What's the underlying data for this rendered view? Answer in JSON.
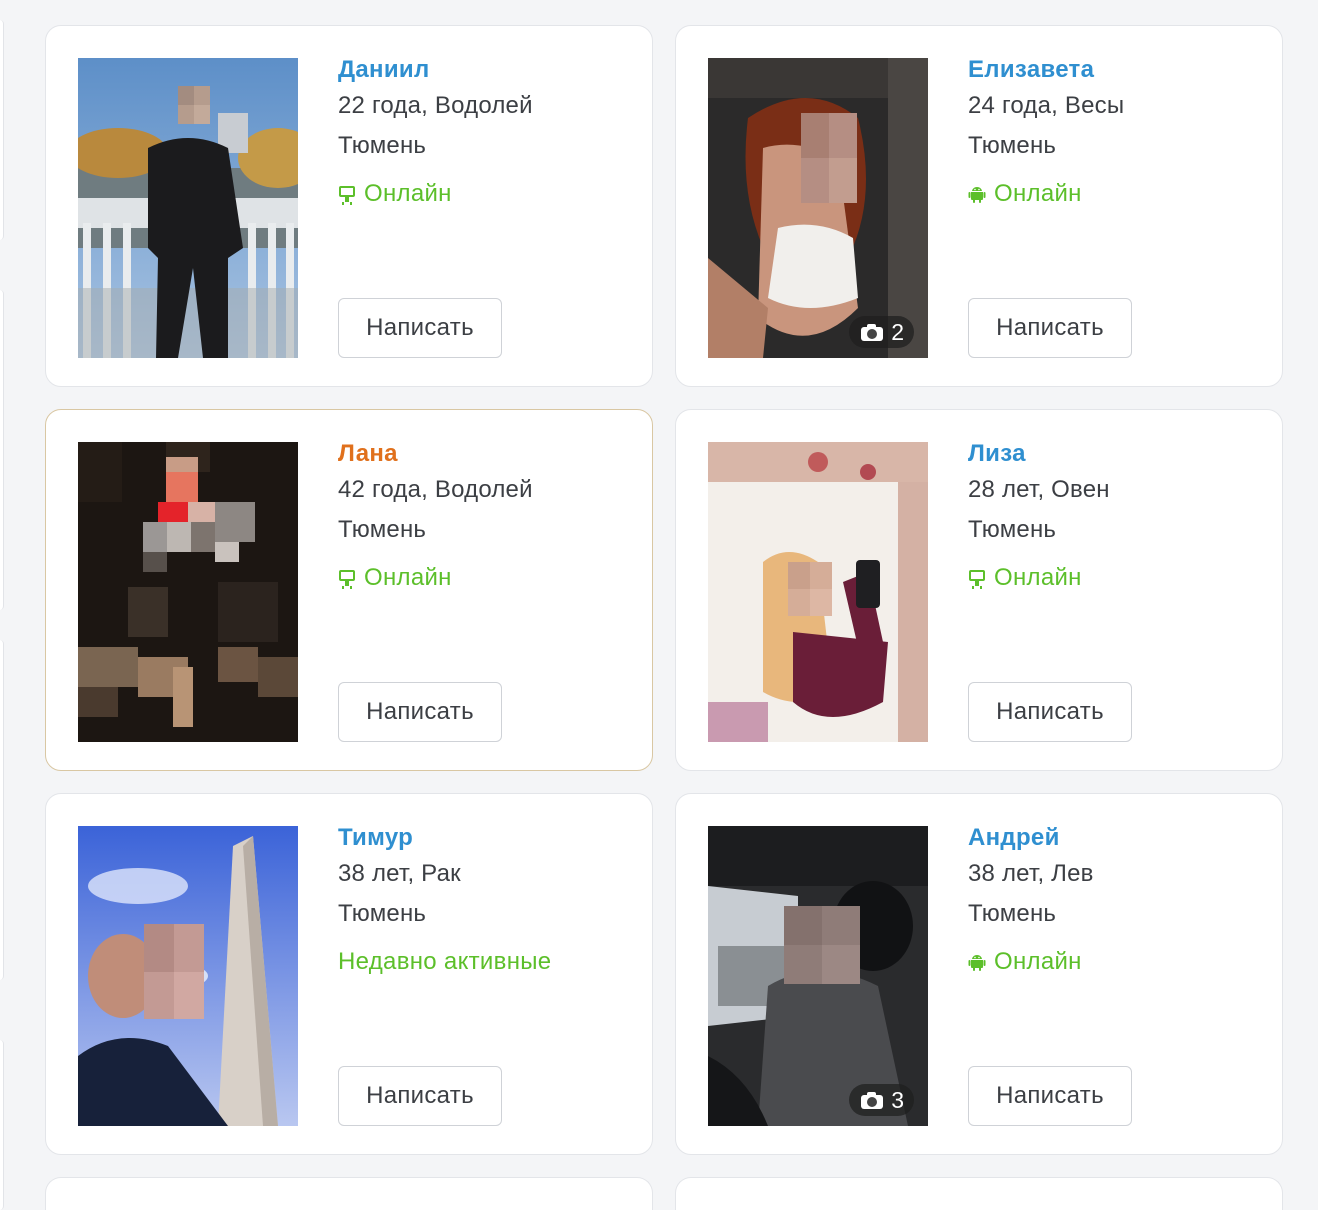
{
  "profiles": [
    {
      "name": "Даниил",
      "age_sign": "22 года, Водолей",
      "city": "Тюмень",
      "status": "Онлайн",
      "status_icon": "monitor-icon",
      "button": "Написать",
      "name_color": "#2f8fd0",
      "highlight": false,
      "photo_count": null
    },
    {
      "name": "Елизавета",
      "age_sign": "24 года, Весы",
      "city": "Тюмень",
      "status": "Онлайн",
      "status_icon": "android-icon",
      "button": "Написать",
      "name_color": "#2f8fd0",
      "highlight": false,
      "photo_count": "2"
    },
    {
      "name": "Лана",
      "age_sign": "42 года, Водолей",
      "city": "Тюмень",
      "status": "Онлайн",
      "status_icon": "monitor-icon",
      "button": "Написать",
      "name_color": "#e0701c",
      "highlight": true,
      "photo_count": null
    },
    {
      "name": "Лиза",
      "age_sign": "28 лет, Овен",
      "city": "Тюмень",
      "status": "Онлайн",
      "status_icon": "monitor-icon",
      "button": "Написать",
      "name_color": "#2f8fd0",
      "highlight": false,
      "photo_count": null
    },
    {
      "name": "Тимур",
      "age_sign": "38 лет, Рак",
      "city": "Тюмень",
      "status": "Недавно активные",
      "status_icon": null,
      "button": "Написать",
      "name_color": "#2f8fd0",
      "highlight": false,
      "photo_count": null
    },
    {
      "name": "Андрей",
      "age_sign": "38 лет, Лев",
      "city": "Тюмень",
      "status": "Онлайн",
      "status_icon": "android-icon",
      "button": "Написать",
      "name_color": "#2f8fd0",
      "highlight": false,
      "photo_count": "3"
    }
  ],
  "colors": {
    "name_link": "#2f8fd0",
    "name_highlight": "#e0701c",
    "online_green": "#5cbf2a",
    "highlight_border": "#d9c7a3"
  }
}
